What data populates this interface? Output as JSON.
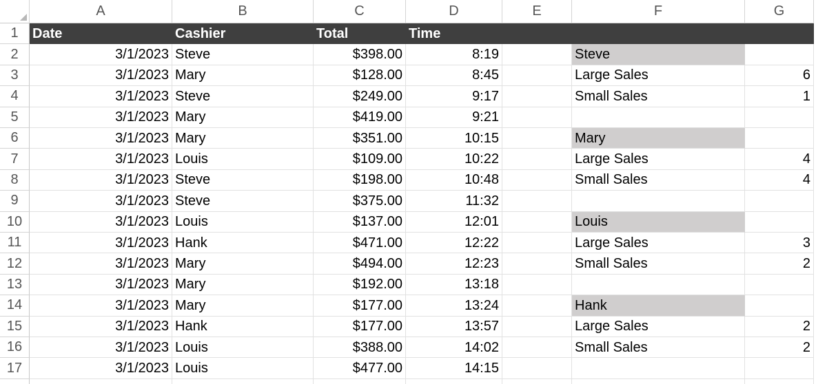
{
  "columns": [
    "A",
    "B",
    "C",
    "D",
    "E",
    "F",
    "G"
  ],
  "row_numbers": [
    "1",
    "2",
    "3",
    "4",
    "5",
    "6",
    "7",
    "8",
    "9",
    "10",
    "11",
    "12",
    "13",
    "14",
    "15",
    "16",
    "17"
  ],
  "header": {
    "date": "Date",
    "cashier": "Cashier",
    "total": "Total",
    "time": "Time"
  },
  "rows": [
    {
      "date": "3/1/2023",
      "cashier": "Steve",
      "total": "$398.00",
      "time": "8:19",
      "f": "Steve",
      "g": "",
      "group": true
    },
    {
      "date": "3/1/2023",
      "cashier": "Mary",
      "total": "$128.00",
      "time": "8:45",
      "f": "Large Sales",
      "g": "6"
    },
    {
      "date": "3/1/2023",
      "cashier": "Steve",
      "total": "$249.00",
      "time": "9:17",
      "f": "Small Sales",
      "g": "1"
    },
    {
      "date": "3/1/2023",
      "cashier": "Mary",
      "total": "$419.00",
      "time": "9:21",
      "f": "",
      "g": ""
    },
    {
      "date": "3/1/2023",
      "cashier": "Mary",
      "total": "$351.00",
      "time": "10:15",
      "f": "Mary",
      "g": "",
      "group": true
    },
    {
      "date": "3/1/2023",
      "cashier": "Louis",
      "total": "$109.00",
      "time": "10:22",
      "f": "Large Sales",
      "g": "4"
    },
    {
      "date": "3/1/2023",
      "cashier": "Steve",
      "total": "$198.00",
      "time": "10:48",
      "f": "Small Sales",
      "g": "4"
    },
    {
      "date": "3/1/2023",
      "cashier": "Steve",
      "total": "$375.00",
      "time": "11:32",
      "f": "",
      "g": ""
    },
    {
      "date": "3/1/2023",
      "cashier": "Louis",
      "total": "$137.00",
      "time": "12:01",
      "f": "Louis",
      "g": "",
      "group": true
    },
    {
      "date": "3/1/2023",
      "cashier": "Hank",
      "total": "$471.00",
      "time": "12:22",
      "f": "Large Sales",
      "g": "3"
    },
    {
      "date": "3/1/2023",
      "cashier": "Mary",
      "total": "$494.00",
      "time": "12:23",
      "f": "Small Sales",
      "g": "2"
    },
    {
      "date": "3/1/2023",
      "cashier": "Mary",
      "total": "$192.00",
      "time": "13:18",
      "f": "",
      "g": ""
    },
    {
      "date": "3/1/2023",
      "cashier": "Mary",
      "total": "$177.00",
      "time": "13:24",
      "f": "Hank",
      "g": "",
      "group": true
    },
    {
      "date": "3/1/2023",
      "cashier": "Hank",
      "total": "$177.00",
      "time": "13:57",
      "f": "Large Sales",
      "g": "2"
    },
    {
      "date": "3/1/2023",
      "cashier": "Louis",
      "total": "$388.00",
      "time": "14:02",
      "f": "Small Sales",
      "g": "2"
    },
    {
      "date": "3/1/2023",
      "cashier": "Louis",
      "total": "$477.00",
      "time": "14:15",
      "f": "",
      "g": ""
    }
  ]
}
